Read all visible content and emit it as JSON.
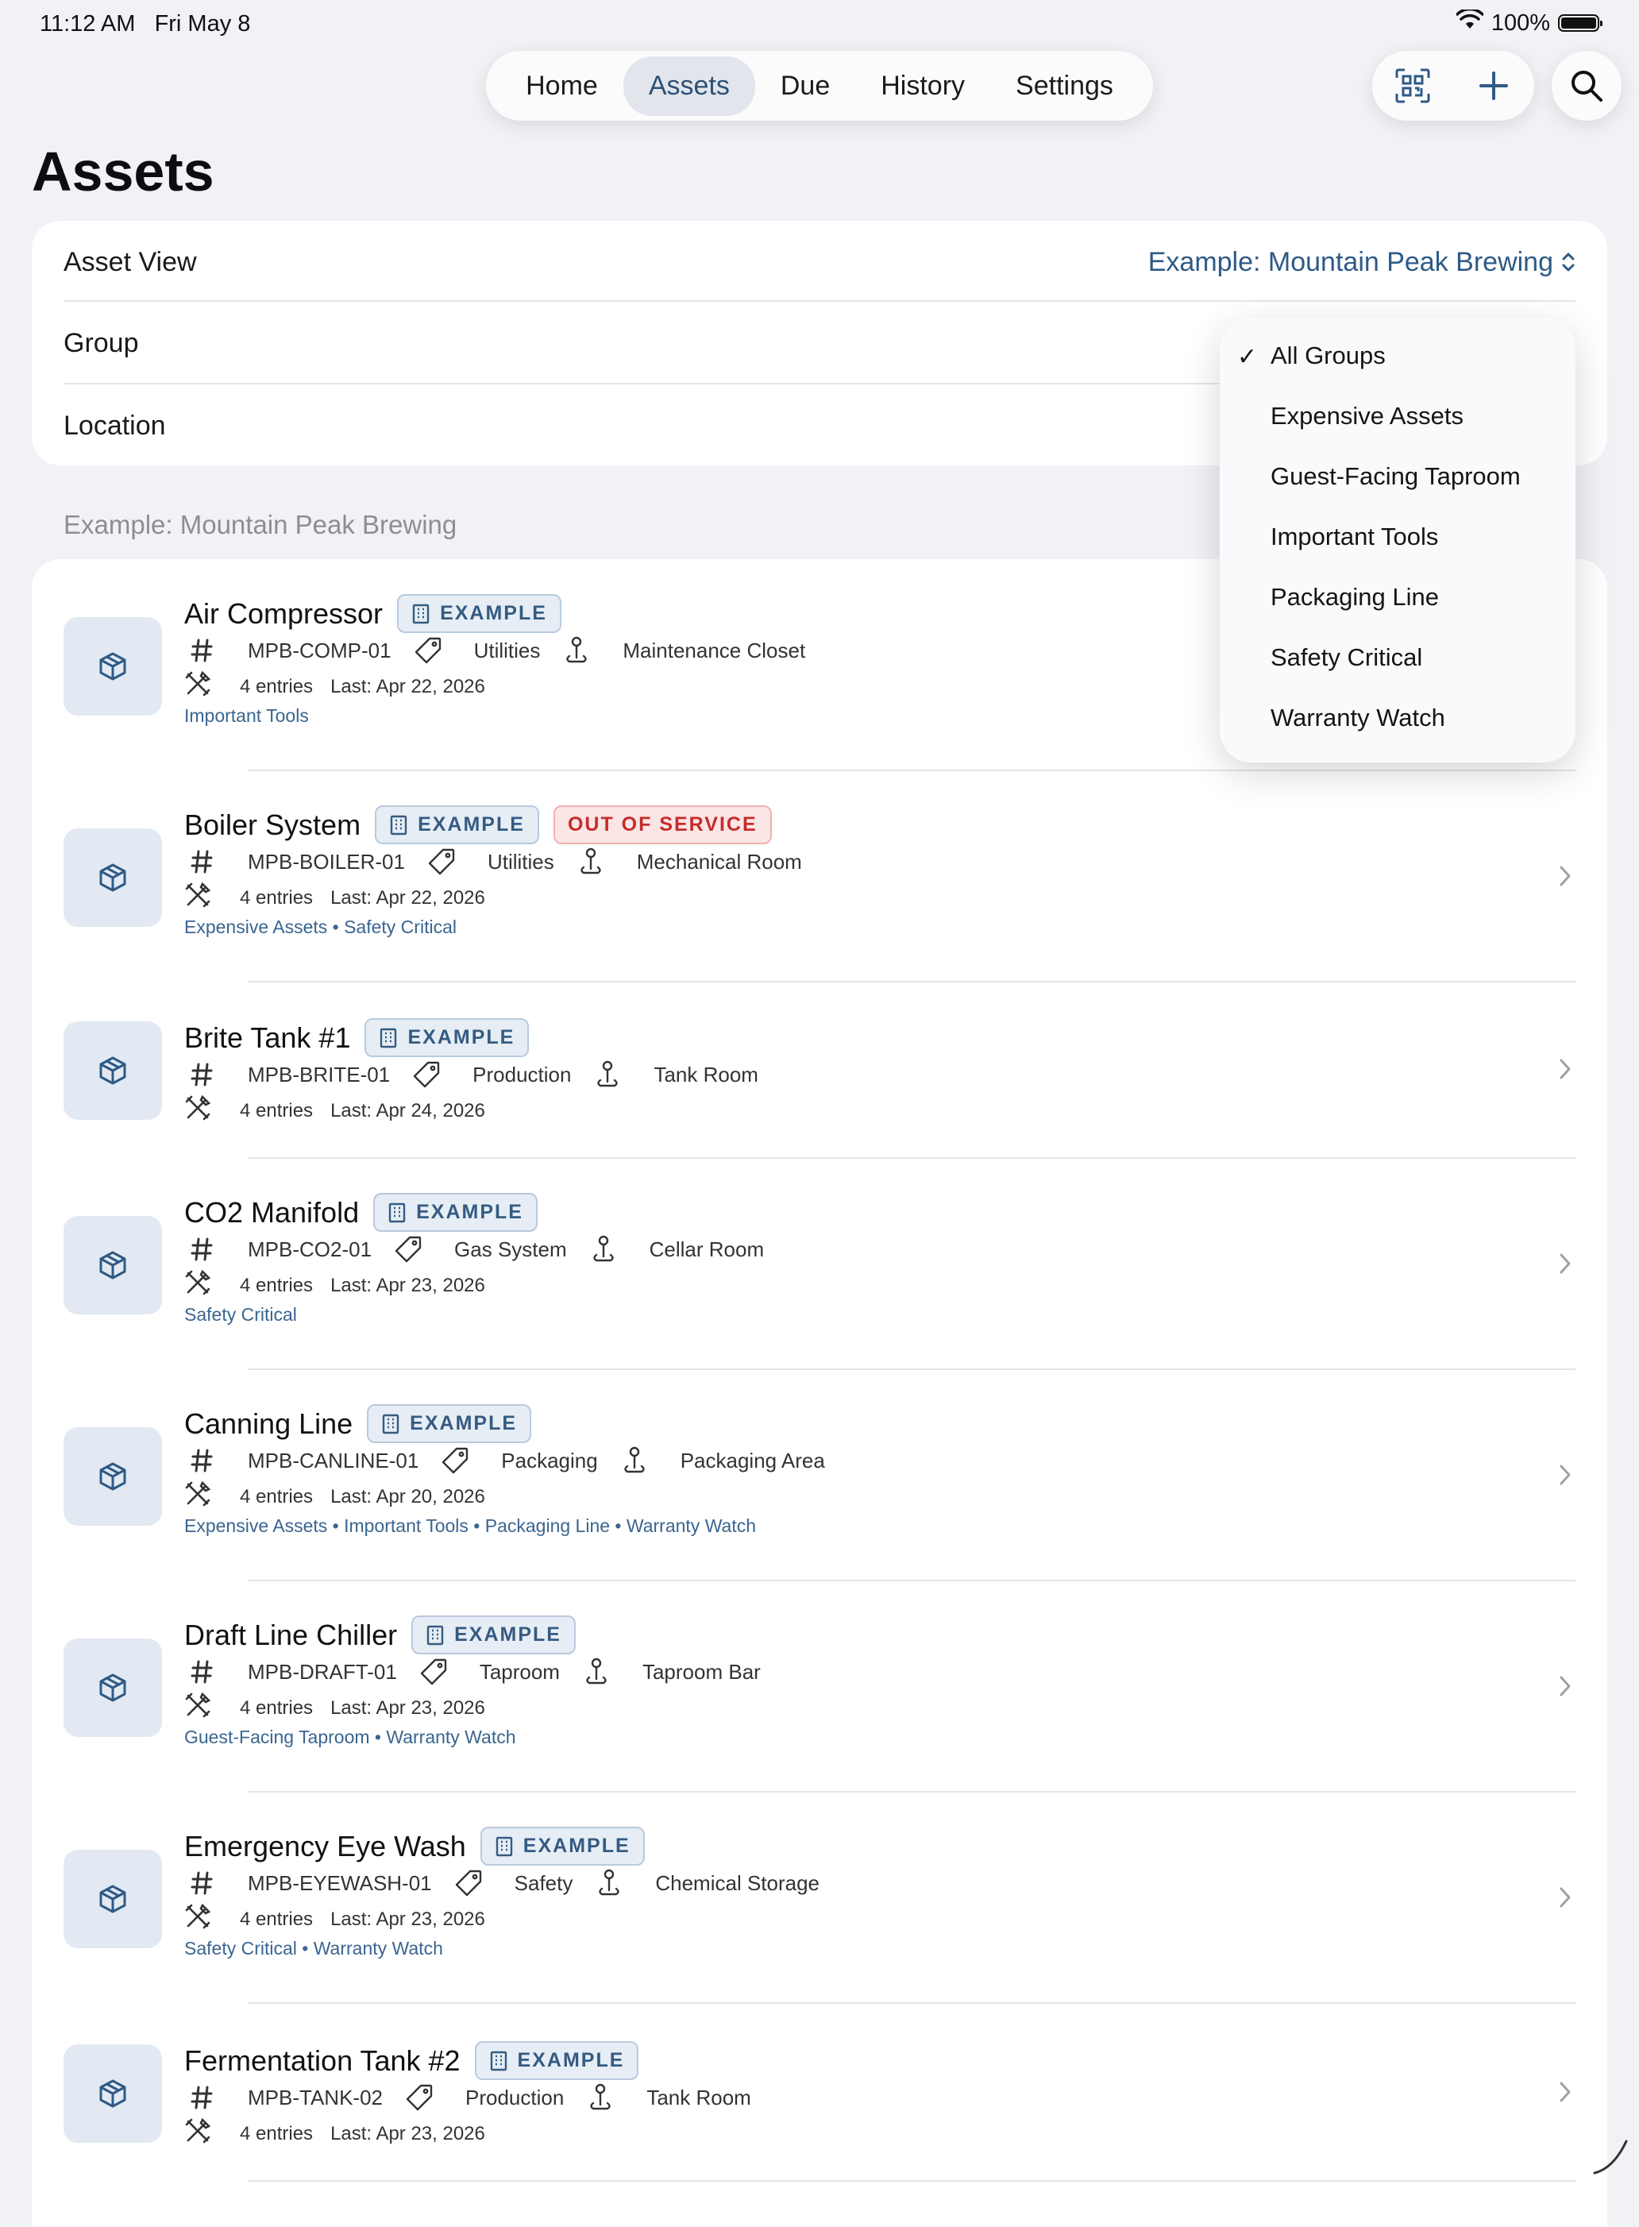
{
  "status_bar": {
    "time": "11:12 AM",
    "date": "Fri May 8",
    "battery": "100%",
    "wifi_icon": "wifi-icon"
  },
  "nav": {
    "tabs": [
      {
        "label": "Home",
        "active": false
      },
      {
        "label": "Assets",
        "active": true
      },
      {
        "label": "Due",
        "active": false
      },
      {
        "label": "History",
        "active": false
      },
      {
        "label": "Settings",
        "active": false
      }
    ],
    "actions": [
      "qr-scan-icon",
      "plus-icon"
    ],
    "search_icon": "search-icon"
  },
  "page": {
    "title": "Assets"
  },
  "filters": {
    "asset_view_label": "Asset View",
    "asset_view_value": "Example: Mountain Peak Brewing",
    "group_label": "Group",
    "location_label": "Location"
  },
  "section": {
    "header": "Example: Mountain Peak Brewing"
  },
  "group_menu": {
    "selected": "All Groups",
    "options": [
      "All Groups",
      "Expensive Assets",
      "Guest-Facing Taproom",
      "Important Tools",
      "Packaging Line",
      "Safety Critical",
      "Warranty Watch"
    ]
  },
  "assets": [
    {
      "name": "Air Compressor",
      "badge": "EXAMPLE",
      "status": "",
      "id": "MPB-COMP-01",
      "category": "Utilities",
      "location": "Maintenance Closet",
      "entries": "4 entries",
      "last": "Last: Apr 22, 2026",
      "tags": "Important Tools"
    },
    {
      "name": "Boiler System",
      "badge": "EXAMPLE",
      "status": "OUT OF SERVICE",
      "id": "MPB-BOILER-01",
      "category": "Utilities",
      "location": "Mechanical Room",
      "entries": "4 entries",
      "last": "Last: Apr 22, 2026",
      "tags": "Expensive Assets • Safety Critical"
    },
    {
      "name": "Brite Tank #1",
      "badge": "EXAMPLE",
      "status": "",
      "id": "MPB-BRITE-01",
      "category": "Production",
      "location": "Tank Room",
      "entries": "4 entries",
      "last": "Last: Apr 24, 2026",
      "tags": ""
    },
    {
      "name": "CO2 Manifold",
      "badge": "EXAMPLE",
      "status": "",
      "id": "MPB-CO2-01",
      "category": "Gas System",
      "location": "Cellar Room",
      "entries": "4 entries",
      "last": "Last: Apr 23, 2026",
      "tags": "Safety Critical"
    },
    {
      "name": "Canning Line",
      "badge": "EXAMPLE",
      "status": "",
      "id": "MPB-CANLINE-01",
      "category": "Packaging",
      "location": "Packaging Area",
      "entries": "4 entries",
      "last": "Last: Apr 20, 2026",
      "tags": "Expensive Assets • Important Tools • Packaging Line • Warranty Watch"
    },
    {
      "name": "Draft Line Chiller",
      "badge": "EXAMPLE",
      "status": "",
      "id": "MPB-DRAFT-01",
      "category": "Taproom",
      "location": "Taproom Bar",
      "entries": "4 entries",
      "last": "Last: Apr 23, 2026",
      "tags": "Guest-Facing Taproom • Warranty Watch"
    },
    {
      "name": "Emergency Eye Wash",
      "badge": "EXAMPLE",
      "status": "",
      "id": "MPB-EYEWASH-01",
      "category": "Safety",
      "location": "Chemical Storage",
      "entries": "4 entries",
      "last": "Last: Apr 23, 2026",
      "tags": "Safety Critical • Warranty Watch"
    },
    {
      "name": "Fermentation Tank #2",
      "badge": "EXAMPLE",
      "status": "",
      "id": "MPB-TANK-02",
      "category": "Production",
      "location": "Tank Room",
      "entries": "4 entries",
      "last": "Last: Apr 23, 2026",
      "tags": ""
    }
  ],
  "colors": {
    "accent": "#2e5a86",
    "badge_bg": "#e6edf5",
    "danger": "#c72b2b",
    "background": "#f1f2f6"
  }
}
